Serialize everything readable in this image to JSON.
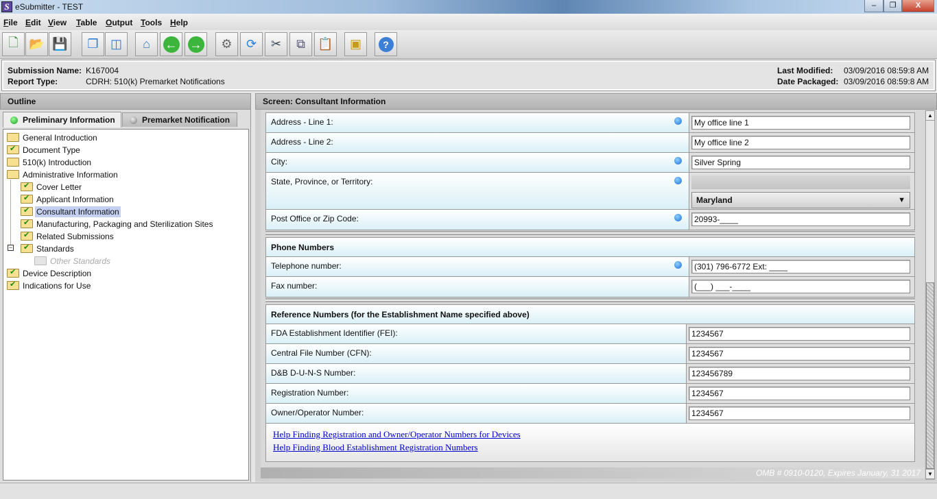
{
  "window": {
    "title": "eSubmitter - TEST",
    "app_icon": "S",
    "minimize": "–",
    "restore": "❐",
    "close": "X"
  },
  "menu": [
    "File",
    "Edit",
    "View",
    "Table",
    "Output",
    "Tools",
    "Help"
  ],
  "toolbar": [
    "new-document-icon",
    "open-folder-icon",
    "save-icon",
    "cascade-windows-icon",
    "tile-windows-icon",
    "home-icon",
    "back-arrow-icon",
    "forward-arrow-icon",
    "run-gears-icon",
    "refresh-icon",
    "cut-icon",
    "copy-icon",
    "paste-icon",
    "package-icon",
    "help-icon"
  ],
  "info": {
    "submission_name_label": "Submission Name:",
    "submission_name": "K167004",
    "report_type_label": "Report Type:",
    "report_type": "CDRH: 510(k) Premarket Notifications",
    "last_modified_label": "Last Modified:",
    "last_modified": "03/09/2016 08:59:8 AM",
    "date_packaged_label": "Date Packaged:",
    "date_packaged": "03/09/2016 08:59:8 AM"
  },
  "outline": {
    "title": "Outline",
    "tabs": [
      "Preliminary Information",
      "Premarket Notification"
    ],
    "items": [
      {
        "label": "General Introduction",
        "level": 0,
        "checked": false
      },
      {
        "label": "Document Type",
        "level": 0,
        "checked": true
      },
      {
        "label": "510(k) Introduction",
        "level": 0,
        "checked": false
      },
      {
        "label": "Administrative Information",
        "level": 0,
        "checked": false
      },
      {
        "label": "Cover Letter",
        "level": 1,
        "checked": true
      },
      {
        "label": "Applicant Information",
        "level": 1,
        "checked": true
      },
      {
        "label": "Consultant Information",
        "level": 1,
        "checked": true,
        "selected": true
      },
      {
        "label": "Manufacturing, Packaging and Sterilization Sites",
        "level": 1,
        "checked": true
      },
      {
        "label": "Related Submissions",
        "level": 1,
        "checked": true
      },
      {
        "label": "Standards",
        "level": 1,
        "checked": true,
        "expanded": true
      },
      {
        "label": "Other Standards",
        "level": 2,
        "disabled": true
      },
      {
        "label": "Device Description",
        "level": 0,
        "checked": true
      },
      {
        "label": "Indications for Use",
        "level": 0,
        "checked": true
      }
    ]
  },
  "screen": {
    "title": "Screen: Consultant Information",
    "address": [
      {
        "label": "Address - Line 1:",
        "value": "My office line 1",
        "required": true
      },
      {
        "label": "Address - Line 2:",
        "value": "My office line 2",
        "required": false
      },
      {
        "label": "City:",
        "value": "Silver Spring",
        "required": true
      }
    ],
    "state": {
      "label": "State, Province, or Territory:",
      "value": "Maryland"
    },
    "zip": {
      "label": "Post Office or Zip Code:",
      "value": "20993-____"
    },
    "phone": {
      "title": "Phone Numbers",
      "rows": [
        {
          "label": "Telephone number:",
          "value": "(301) 796-6772 Ext: ____",
          "required": true
        },
        {
          "label": "Fax number:",
          "value": "(___) ___-____",
          "required": false
        }
      ]
    },
    "reference": {
      "title": "Reference Numbers (for the Establishment Name specified above)",
      "rows": [
        {
          "label": "FDA Establishment Identifier (FEI):",
          "value": "1234567"
        },
        {
          "label": "Central File Number (CFN):",
          "value": "1234567"
        },
        {
          "label": "D&B D-U-N-S Number:",
          "value": "123456789"
        },
        {
          "label": "Registration Number:",
          "value": "1234567"
        },
        {
          "label": "Owner/Operator Number:",
          "value": "1234567"
        }
      ],
      "links": [
        "Help Finding Registration and Owner/Operator Numbers for Devices",
        "Help Finding Blood Establishment Registration Numbers"
      ]
    },
    "omb": "OMB # 0910-0120, Expires January, 31 2017"
  }
}
